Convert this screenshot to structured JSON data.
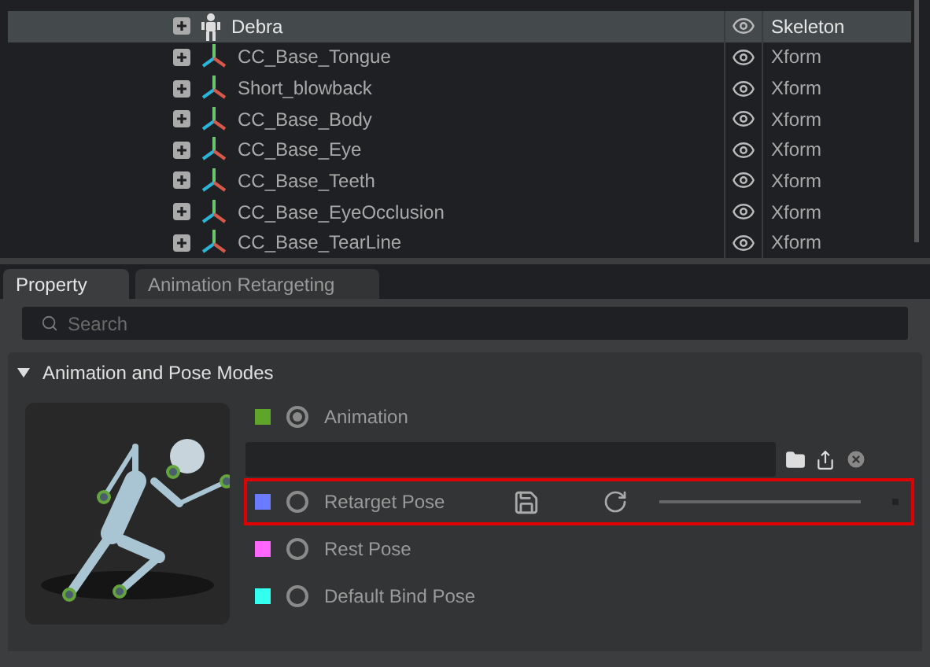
{
  "tree": {
    "rows": [
      {
        "name": "Debra",
        "kind": "skeleton",
        "type": "Skeleton",
        "selected": true
      },
      {
        "name": "CC_Base_Tongue",
        "kind": "xform",
        "type": "Xform",
        "selected": false
      },
      {
        "name": "Short_blowback",
        "kind": "xform",
        "type": "Xform",
        "selected": false
      },
      {
        "name": "CC_Base_Body",
        "kind": "xform",
        "type": "Xform",
        "selected": false
      },
      {
        "name": "CC_Base_Eye",
        "kind": "xform",
        "type": "Xform",
        "selected": false
      },
      {
        "name": "CC_Base_Teeth",
        "kind": "xform",
        "type": "Xform",
        "selected": false
      },
      {
        "name": "CC_Base_EyeOcclusion",
        "kind": "xform",
        "type": "Xform",
        "selected": false
      },
      {
        "name": "CC_Base_TearLine",
        "kind": "xform",
        "type": "Xform",
        "selected": false
      }
    ]
  },
  "tabs": [
    {
      "label": "Property",
      "selected": true
    },
    {
      "label": "Animation Retargeting",
      "selected": false
    }
  ],
  "search": {
    "placeholder": "Search"
  },
  "section": {
    "title": "Animation and Pose Modes",
    "expanded": true,
    "modes": [
      {
        "label": "Animation",
        "color": "#5fa52a",
        "selected": true,
        "kind": "animation"
      },
      {
        "label": "Retarget Pose",
        "color": "#6b7bff",
        "selected": false,
        "kind": "retarget",
        "highlighted": true
      },
      {
        "label": "Rest Pose",
        "color": "#ff66ff",
        "selected": false,
        "kind": "plain"
      },
      {
        "label": "Default Bind Pose",
        "color": "#33ffee",
        "selected": false,
        "kind": "plain"
      }
    ]
  }
}
